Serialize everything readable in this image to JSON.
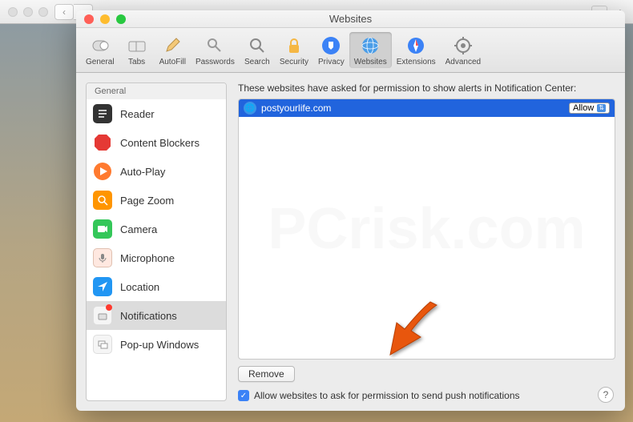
{
  "window": {
    "title": "Websites"
  },
  "toolbar": {
    "items": [
      {
        "label": "General"
      },
      {
        "label": "Tabs"
      },
      {
        "label": "AutoFill"
      },
      {
        "label": "Passwords"
      },
      {
        "label": "Search"
      },
      {
        "label": "Security"
      },
      {
        "label": "Privacy"
      },
      {
        "label": "Websites"
      },
      {
        "label": "Extensions"
      },
      {
        "label": "Advanced"
      }
    ]
  },
  "sidebar": {
    "header": "General",
    "items": [
      {
        "label": "Reader"
      },
      {
        "label": "Content Blockers"
      },
      {
        "label": "Auto-Play"
      },
      {
        "label": "Page Zoom"
      },
      {
        "label": "Camera"
      },
      {
        "label": "Microphone"
      },
      {
        "label": "Location"
      },
      {
        "label": "Notifications"
      },
      {
        "label": "Pop-up Windows"
      }
    ]
  },
  "main": {
    "description": "These websites have asked for permission to show alerts in Notification Center:",
    "site": "postyourlife.com",
    "permission": "Allow",
    "remove_label": "Remove",
    "checkbox_label": "Allow websites to ask for permission to send push notifications"
  },
  "help": "?"
}
